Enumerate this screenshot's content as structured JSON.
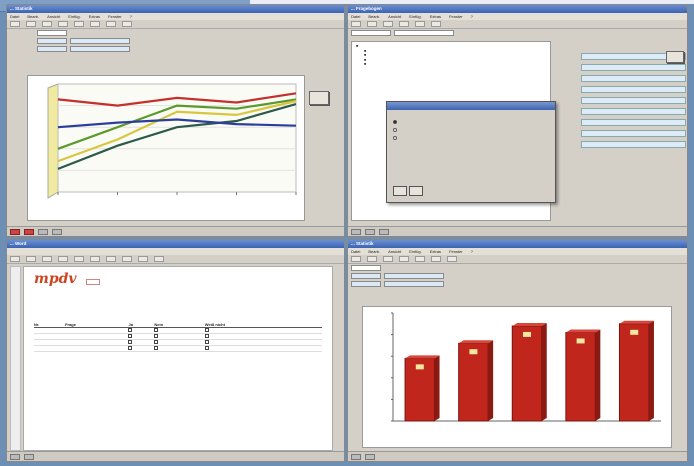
{
  "colors": {
    "line_red": "#c4302b",
    "line_green": "#5a9a2a",
    "line_yellow": "#d8c640",
    "line_blue": "#2b3f9a",
    "line_dark": "#2d5a4a",
    "bar_red": "#c0261c",
    "chart_floor": "#f0e9a0"
  },
  "q1": {
    "title": "... Statistik",
    "menu": [
      "Datei",
      "Bearb.",
      "Ansicht",
      "Einfüg.",
      "Extras",
      "Fenster",
      "?"
    ],
    "form": {
      "row1": "",
      "row2": "",
      "row3": ""
    },
    "chart_title": "",
    "side_button": ""
  },
  "q2": {
    "title": "... Fragebogen",
    "menu": [
      "Datei",
      "Bearb.",
      "Ansicht",
      "Einfüg.",
      "Extras",
      "Fenster",
      "?"
    ],
    "dialog": {
      "title": "",
      "line1": "",
      "line2": "",
      "options": [
        "",
        "",
        ""
      ],
      "btn_ok": "",
      "btn_cancel": ""
    }
  },
  "q3": {
    "title": "... Word",
    "logo": "mpdv",
    "logo_tag": "",
    "table_headers": [
      "Nr.",
      "Frage",
      "Ja",
      "Nein",
      "Weiß nicht"
    ]
  },
  "q4": {
    "title": "... Statistik",
    "menu": [
      "Datei",
      "Bearb.",
      "Ansicht",
      "Einfüg.",
      "Extras",
      "Fenster",
      "?"
    ],
    "chart_title": ""
  },
  "chart_data": [
    {
      "type": "line",
      "title": "",
      "x": [
        "",
        "",
        "",
        "",
        ""
      ],
      "series": [
        {
          "values": [
            90,
            86,
            91,
            88,
            94
          ]
        },
        {
          "values": [
            58,
            72,
            86,
            84,
            90
          ]
        },
        {
          "values": [
            50,
            64,
            82,
            80,
            89
          ]
        },
        {
          "values": [
            45,
            60,
            72,
            76,
            87
          ]
        },
        {
          "values": [
            72,
            75,
            77,
            74,
            73
          ]
        }
      ],
      "ylim": [
        30,
        100
      ]
    },
    {
      "type": "bar",
      "title": "",
      "categories": [
        "",
        "",
        "",
        "",
        ""
      ],
      "values": [
        58,
        72,
        88,
        82,
        90
      ],
      "ylim": [
        0,
        100
      ]
    }
  ]
}
